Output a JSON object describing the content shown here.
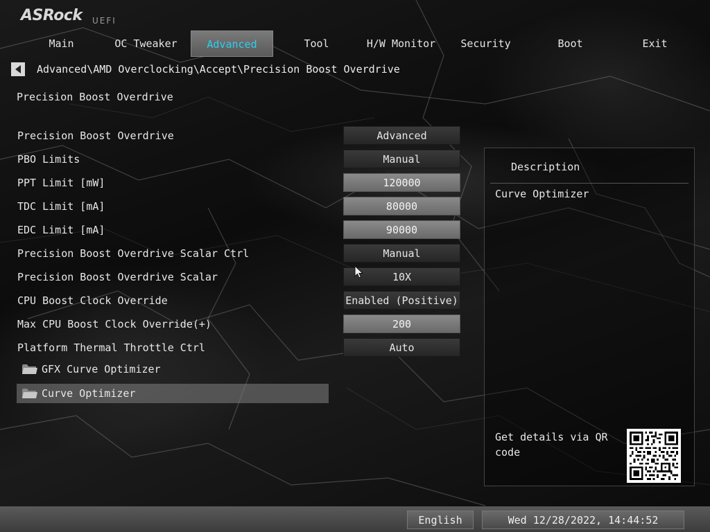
{
  "brand": {
    "name": "ASRock",
    "sub": "UEFI"
  },
  "tabs": [
    {
      "label": "Main"
    },
    {
      "label": "OC Tweaker"
    },
    {
      "label": "Advanced",
      "active": true
    },
    {
      "label": "Tool"
    },
    {
      "label": "H/W Monitor"
    },
    {
      "label": "Security"
    },
    {
      "label": "Boot"
    },
    {
      "label": "Exit"
    }
  ],
  "breadcrumb": "Advanced\\AMD Overclocking\\Accept\\Precision Boost Overdrive",
  "page_title": "Precision Boost Overdrive",
  "settings": [
    {
      "label": "Precision Boost Overdrive",
      "value": "Advanced"
    },
    {
      "label": "PBO Limits",
      "value": "Manual"
    },
    {
      "label": "PPT Limit [mW]",
      "value": "120000"
    },
    {
      "label": "TDC Limit [mA]",
      "value": "80000"
    },
    {
      "label": "EDC Limit [mA]",
      "value": "90000"
    },
    {
      "label": "Precision Boost Overdrive Scalar Ctrl",
      "value": "Manual"
    },
    {
      "label": "Precision Boost Overdrive Scalar",
      "value": "10X"
    },
    {
      "label": "CPU Boost Clock Override",
      "value": "Enabled (Positive)"
    },
    {
      "label": "Max CPU Boost Clock Override(+)",
      "value": "200"
    },
    {
      "label": "Platform Thermal Throttle Ctrl",
      "value": "Auto"
    }
  ],
  "submenus": [
    {
      "label": "GFX Curve Optimizer"
    },
    {
      "label": "Curve Optimizer",
      "selected": true
    }
  ],
  "description": {
    "title": "Description",
    "text": "Curve Optimizer",
    "qr_text": "Get details via QR code"
  },
  "status": {
    "language": "English",
    "datetime": "Wed 12/28/2022, 14:44:52"
  },
  "colors": {
    "accent": "#2ad0f0",
    "numeric_field": "#7a7a7a",
    "option_field": "#2e2e2e"
  },
  "icons": [
    "back-arrow-icon",
    "folder-icon",
    "qr-code-icon",
    "mouse-cursor-icon"
  ]
}
